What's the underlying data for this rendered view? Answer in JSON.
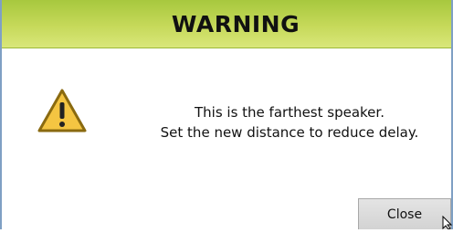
{
  "dialog": {
    "title": "WARNING",
    "icon": "warning-triangle-icon",
    "message_lines": [
      "This is the farthest speaker.",
      "Set the new distance to reduce delay."
    ],
    "close_label": "Close"
  },
  "colors": {
    "titlebar_start": "#a7c83e",
    "titlebar_end": "#d9e77a",
    "warning_fill": "#f4c542",
    "warning_stroke": "#8a6a10",
    "window_border": "#7fa0c4",
    "button_bg": "#d9d9d9"
  }
}
